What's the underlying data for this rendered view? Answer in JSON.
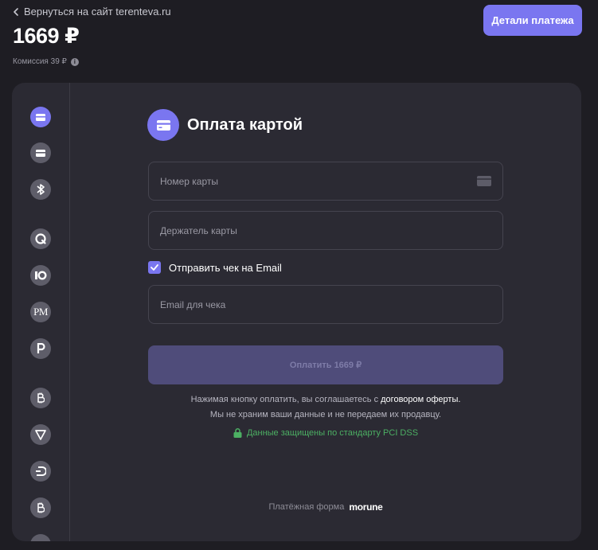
{
  "header": {
    "back_label": "Вернуться на сайт terenteva.ru",
    "price": "1669 ₽",
    "commission": "Комиссия 39 ₽",
    "details_button": "Детали платежа"
  },
  "sidebar": {
    "items": [
      {
        "name": "card",
        "icon": "card-icon",
        "active": true
      },
      {
        "name": "card-alt",
        "icon": "card-icon",
        "active": false
      },
      {
        "name": "sbp",
        "icon": "sbp-icon",
        "active": false
      },
      {
        "name": "qiwi",
        "icon": "qiwi-icon",
        "active": false
      },
      {
        "name": "yoomoney",
        "icon": "yoomoney-icon",
        "active": false
      },
      {
        "name": "perfectmoney",
        "icon": "pm-icon",
        "label": "PM",
        "active": false
      },
      {
        "name": "payeer",
        "icon": "payeer-icon",
        "active": false
      },
      {
        "name": "bitcoin",
        "icon": "bitcoin-icon",
        "active": false
      },
      {
        "name": "tron",
        "icon": "tron-icon",
        "active": false
      },
      {
        "name": "dash",
        "icon": "dash-icon",
        "active": false
      },
      {
        "name": "bitcoin-cash",
        "icon": "bitcoin-icon",
        "active": false
      }
    ]
  },
  "form": {
    "title": "Оплата картой",
    "card_number_placeholder": "Номер карты",
    "card_holder_placeholder": "Держатель карты",
    "send_receipt_label": "Отправить чек на Email",
    "send_receipt_checked": true,
    "email_placeholder": "Email для чека",
    "pay_button": "Оплатить 1669 ₽",
    "legal_prefix": "Нажимая кнопку оплатить, вы соглашаетесь с",
    "legal_link": "договором оферты.",
    "legal_line2": "Мы не храним ваши данные и не передаем их продавцу.",
    "secure_text": "Данные защищены по стандарту PCI DSS",
    "footer_label": "Платёжная форма",
    "footer_brand": "morune"
  },
  "colors": {
    "accent": "#7a76f0",
    "background": "#1e1d23",
    "card": "#2b2a33",
    "secure": "#4caf63"
  }
}
